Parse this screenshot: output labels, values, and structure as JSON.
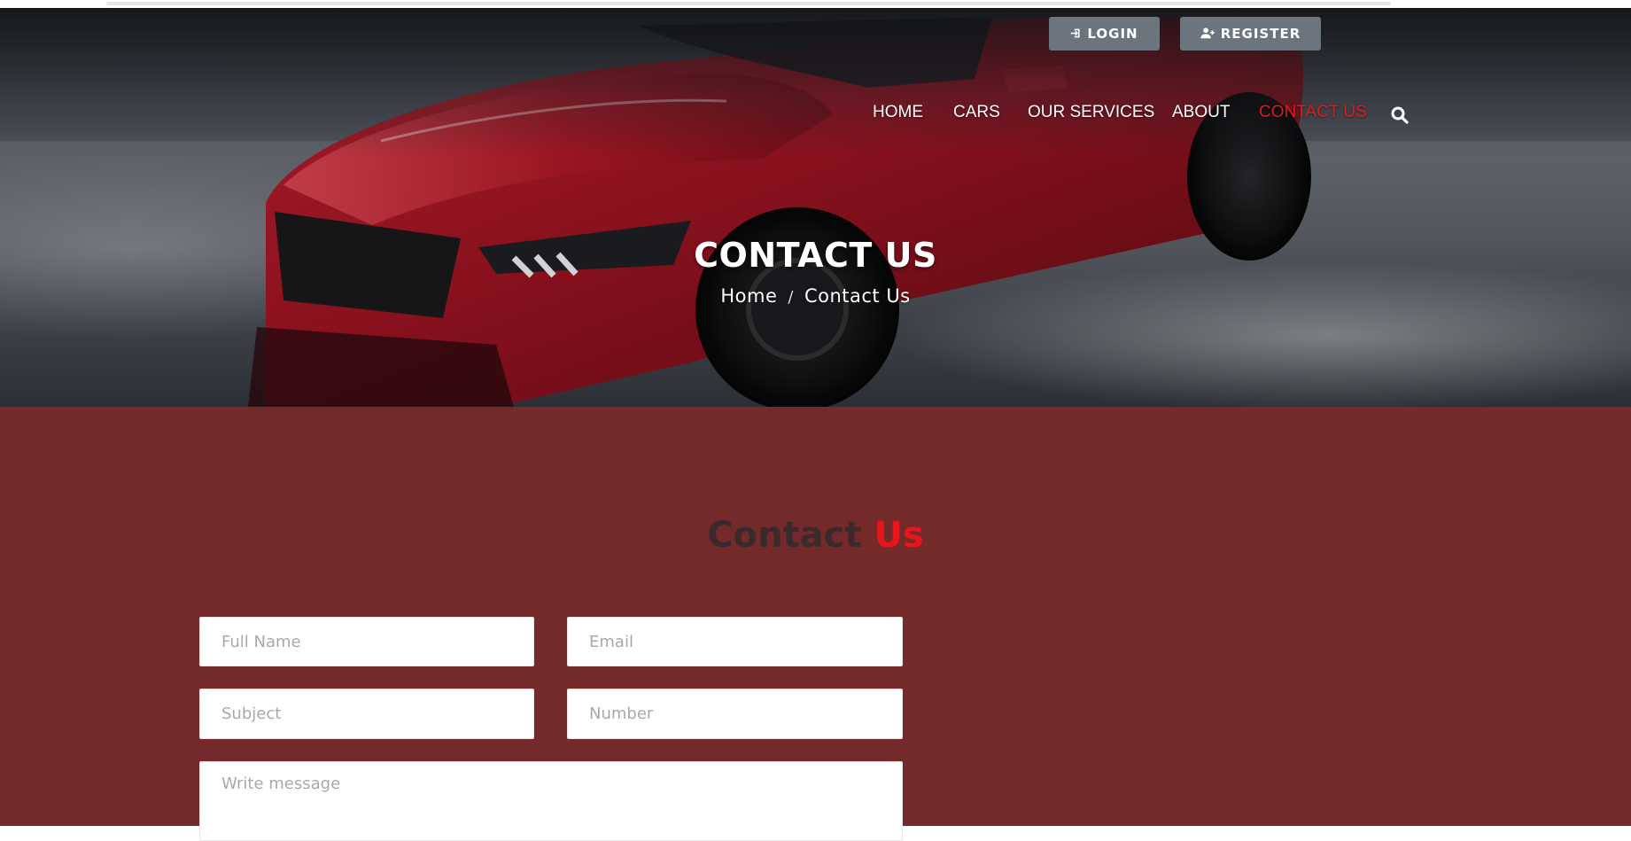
{
  "auth": {
    "login_label": "LOGIN",
    "register_label": "REGISTER",
    "login_icon": "sign-in-icon",
    "register_icon": "user-plus-icon"
  },
  "nav": {
    "items": [
      {
        "label": "HOME",
        "active": false
      },
      {
        "label": "CARS",
        "active": false
      },
      {
        "label": "OUR SERVICES",
        "active": false
      },
      {
        "label": "ABOUT",
        "active": false
      },
      {
        "label": "CONTACT US",
        "active": true
      }
    ],
    "search_icon": "search-icon"
  },
  "hero": {
    "title": "CONTACT US",
    "breadcrumb": {
      "home": "Home",
      "separator": "/",
      "current": "Contact Us"
    }
  },
  "contact": {
    "title_part1": "Contact",
    "title_part2": "Us",
    "form": {
      "full_name_placeholder": "Full Name",
      "email_placeholder": "Email",
      "subject_placeholder": "Subject",
      "number_placeholder": "Number",
      "message_placeholder": "Write message"
    }
  },
  "colors": {
    "accent": "#e5161c",
    "section_bg": "#74292b",
    "button_bg": "#6c757d"
  }
}
